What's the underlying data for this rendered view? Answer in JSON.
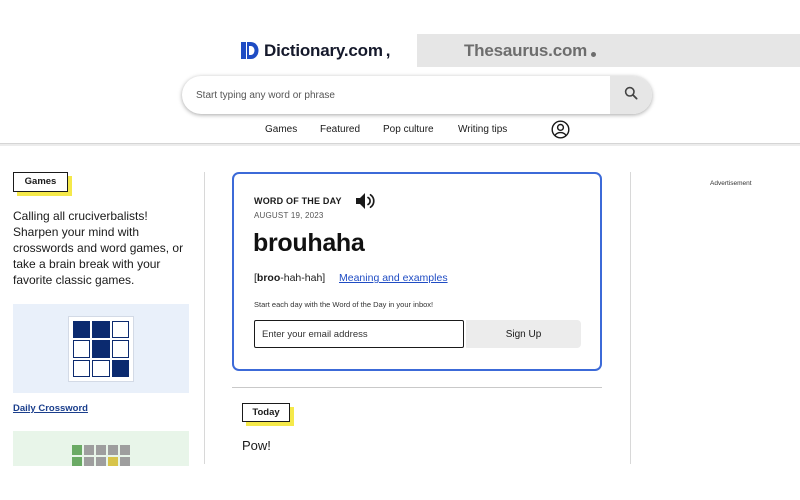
{
  "header": {
    "dictionary_brand": "Dictionary.com",
    "thesaurus_brand": "Thesaurus.com",
    "search_placeholder": "Start typing any word or phrase",
    "nav": [
      "Games",
      "Featured",
      "Pop culture",
      "Writing tips"
    ]
  },
  "sidebar": {
    "games_badge": "Games",
    "games_description": "Calling all cruciverbalists! Sharpen your mind with crosswords and word games, or take a brain break with your favorite classic games.",
    "crossword_link": "Daily Crossword"
  },
  "wotd": {
    "label": "WORD OF THE DAY",
    "date": "AUGUST 19, 2023",
    "word": "brouhaha",
    "pron_open": "[",
    "pron_stressed": "broo",
    "pron_rest": "-hah-hah",
    "pron_close": "]",
    "meaning_link": "Meaning and examples",
    "newsletter_prompt": "Start each day with the Word of the Day in your inbox!",
    "email_placeholder": "Enter your email address",
    "signup_label": "Sign Up"
  },
  "today": {
    "badge": "Today",
    "text": "Pow!"
  },
  "ads": {
    "label": "Advertisement"
  },
  "colors": {
    "card_border": "#3c6ad8",
    "badge_shadow": "#f5e94a",
    "link": "#1f4cc4",
    "crossword_fill": "#0b2a6f"
  }
}
